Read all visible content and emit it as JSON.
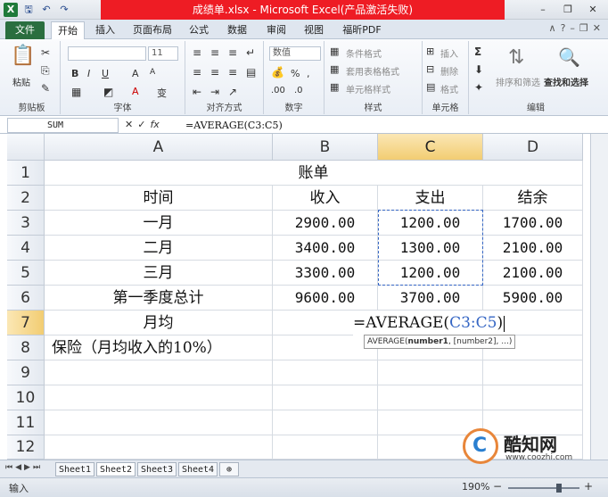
{
  "window": {
    "title": "成绩单.xlsx - Microsoft Excel(产品激活失败)",
    "app_icon": "X"
  },
  "tabs": {
    "file": "文件",
    "items": [
      "开始",
      "插入",
      "页面布局",
      "公式",
      "数据",
      "审阅",
      "视图",
      "福昕PDF"
    ]
  },
  "ribbon": {
    "clipboard": {
      "label": "剪贴板",
      "paste": "粘贴"
    },
    "font": {
      "label": "字体",
      "size": "11"
    },
    "alignment": {
      "label": "对齐方式"
    },
    "number": {
      "label": "数字",
      "format": "数值",
      "percent": "%"
    },
    "styles": {
      "label": "样式",
      "cond": "条件格式",
      "table": "套用表格格式",
      "cell": "单元格样式"
    },
    "cells": {
      "label": "单元格",
      "insert": "插入",
      "delete": "删除",
      "format": "格式"
    },
    "editing": {
      "label": "编辑",
      "sort": "排序和筛选",
      "find": "查找和选择"
    }
  },
  "formula_bar": {
    "name_box": "SUM",
    "formula": "=AVERAGE(C3:C5)"
  },
  "columns": [
    "A",
    "B",
    "C",
    "D"
  ],
  "rows": [
    "1",
    "2",
    "3",
    "4",
    "5",
    "6",
    "7",
    "8",
    "9",
    "10",
    "11",
    "12"
  ],
  "cells": {
    "r1": {
      "title": "账单"
    },
    "r2": {
      "a": "时间",
      "b": "收入",
      "c": "支出",
      "d": "结余"
    },
    "r3": {
      "a": "一月",
      "b": "2900.00",
      "c": "1200.00",
      "d": "1700.00"
    },
    "r4": {
      "a": "二月",
      "b": "3400.00",
      "c": "1300.00",
      "d": "2100.00"
    },
    "r5": {
      "a": "三月",
      "b": "3300.00",
      "c": "1200.00",
      "d": "2100.00"
    },
    "r6": {
      "a": "第一季度总计",
      "b": "9600.00",
      "c": "3700.00",
      "d": "5900.00"
    },
    "r7": {
      "a": "月均",
      "edit_prefix": "=AVERAGE(",
      "edit_ref": "C3:C5",
      "edit_suffix": ")"
    },
    "r8": {
      "a": "保险（月均收入的10%）"
    }
  },
  "tooltip": {
    "fn": "AVERAGE(",
    "arg1": "number1",
    "rest": ", [number2], ...)"
  },
  "sheets": [
    "Sheet1",
    "Sheet2",
    "Sheet3",
    "Sheet4"
  ],
  "active_sheet": "Sheet2",
  "status": {
    "mode": "输入",
    "zoom": "190%"
  },
  "watermark": {
    "name": "酷知网",
    "url": "www.coozhi.com"
  },
  "colors": {
    "title_red": "#ee1c24",
    "file_tab": "#2a6e3f",
    "ref_blue": "#3566c4",
    "selected_header": "#f2cd72"
  }
}
